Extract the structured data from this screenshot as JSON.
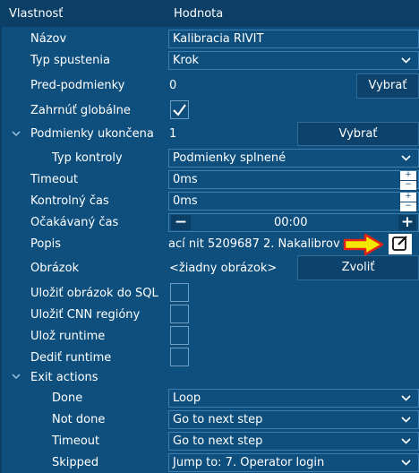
{
  "header": {
    "property": "Vlastnosť",
    "value": "Hodnota"
  },
  "rows": {
    "nazov": {
      "label": "Názov",
      "value": "Kalibracia RIVIT"
    },
    "typ_spustenia": {
      "label": "Typ spustenia",
      "value": "Krok"
    },
    "pred_podmienky": {
      "label": "Pred-podmienky",
      "value": "0",
      "button": "Vybrať"
    },
    "zahrnut_globalne": {
      "label": "Zahrnúť globálne",
      "checked": true
    },
    "podmienky_ukoncena": {
      "label": "Podmienky ukončena",
      "value": "1",
      "button": "Vybrať"
    },
    "typ_kontroly": {
      "label": "Typ kontroly",
      "value": "Podmienky splnené"
    },
    "timeout": {
      "label": "Timeout",
      "value": "0ms"
    },
    "kontrolny_cas": {
      "label": "Kontrolný čas",
      "value": "0ms"
    },
    "ocakavany_cas": {
      "label": "Očakávaný čas",
      "value": "00:00",
      "minus": "−",
      "plus": "+"
    },
    "popis": {
      "label": "Popis",
      "value": "ací nit 5209687 2. Nakalibrov"
    },
    "obrazok": {
      "label": "Obrázok",
      "value": "<žiadny obrázok>",
      "button": "Zvoliť"
    },
    "ulozit_sql": {
      "label": "Uložiť obrázok do SQL"
    },
    "ulozit_cnn": {
      "label": "Uložiť CNN regióny"
    },
    "uloz_runtime": {
      "label": "Ulož runtime"
    },
    "dedit_runtime": {
      "label": "Dediť runtime"
    },
    "exit_actions": {
      "label": "Exit actions"
    },
    "done": {
      "label": "Done",
      "value": "Loop"
    },
    "not_done": {
      "label": "Not done",
      "value": "Go to next step"
    },
    "timeout_action": {
      "label": "Timeout",
      "value": "Go to next step"
    },
    "skipped": {
      "label": "Skipped",
      "value": "Jump to: 7. Operator login"
    }
  },
  "spin": {
    "up": "+",
    "down": "−"
  },
  "icons": {
    "expand": "chevron-down-icon",
    "dropdown": "chevron-down-icon",
    "edit": "edit-icon",
    "annotation": "yellow-arrow-icon",
    "check": "check-icon"
  },
  "colors": {
    "background": "#0e4f7d",
    "header": "#0b3f66",
    "arrow": "#f5e600",
    "arrow_edge": "#e0201b"
  }
}
